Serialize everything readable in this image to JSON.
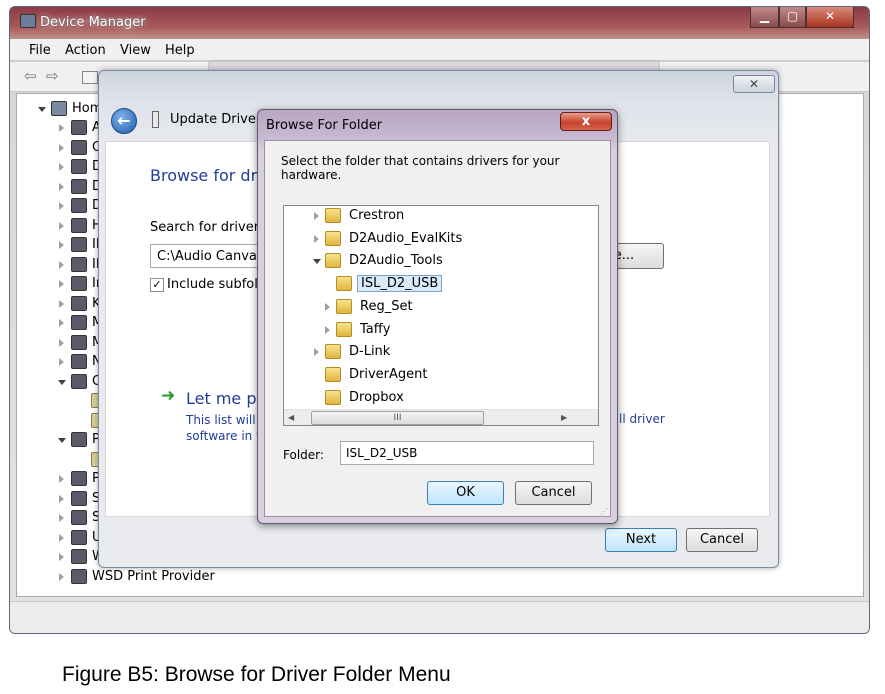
{
  "device_manager": {
    "title": "Device Manager",
    "menu": [
      "File",
      "Action",
      "View",
      "Help"
    ],
    "tree": {
      "root": "Home",
      "items": [
        "Ac",
        "Co",
        "Di",
        "Di",
        "DV",
        "Hu",
        "ID",
        "IE",
        "Im",
        "Ke",
        "Mi",
        "Mo",
        "Ne",
        "Ot",
        "",
        "",
        "Po",
        "",
        "Pr",
        "So",
        "Sy",
        "Ur",
        "Wi",
        "WSD Print Provider"
      ]
    }
  },
  "update_driver": {
    "title": "Update Driver S",
    "close_symbol": "✕",
    "heading": "Browse for driv",
    "search_label": "Search for driver so",
    "path_value": "C:\\Audio Canvas I",
    "browse_label": "se...",
    "include_subfolders_label": "Include subfolde",
    "include_subfolders_checked": "✓",
    "let_me_pick_title": "Let me pic",
    "let_me_pick_desc": "This list will s",
    "let_me_pick_desc2": "software in th",
    "let_me_pick_desc_right": "ll driver",
    "next_label": "Next",
    "cancel_label": "Cancel"
  },
  "browse_for_folder": {
    "title": "Browse For Folder",
    "close_symbol": "x",
    "instruction": "Select the folder that contains drivers for your hardware.",
    "folders": [
      {
        "label": "Crestron",
        "expandable": true,
        "expanded": false,
        "level": 0,
        "selected": false
      },
      {
        "label": "D2Audio_EvalKits",
        "expandable": true,
        "expanded": false,
        "level": 0,
        "selected": false
      },
      {
        "label": "D2Audio_Tools",
        "expandable": true,
        "expanded": true,
        "level": 0,
        "selected": false
      },
      {
        "label": "ISL_D2_USB",
        "expandable": false,
        "expanded": false,
        "level": 1,
        "selected": true
      },
      {
        "label": "Reg_Set",
        "expandable": true,
        "expanded": false,
        "level": 1,
        "selected": false
      },
      {
        "label": "Taffy",
        "expandable": true,
        "expanded": false,
        "level": 1,
        "selected": false
      },
      {
        "label": "D-Link",
        "expandable": true,
        "expanded": false,
        "level": 0,
        "selected": false
      },
      {
        "label": "DriverAgent",
        "expandable": false,
        "expanded": false,
        "level": 0,
        "selected": false
      },
      {
        "label": "Dropbox",
        "expandable": false,
        "expanded": false,
        "level": 0,
        "selected": false
      }
    ],
    "hscroll_grip": "III",
    "folder_label": "Folder:",
    "folder_value": "ISL_D2_USB",
    "ok_label": "OK",
    "cancel_label": "Cancel"
  },
  "caption": "Figure B5:  Browse for Driver Folder Menu"
}
